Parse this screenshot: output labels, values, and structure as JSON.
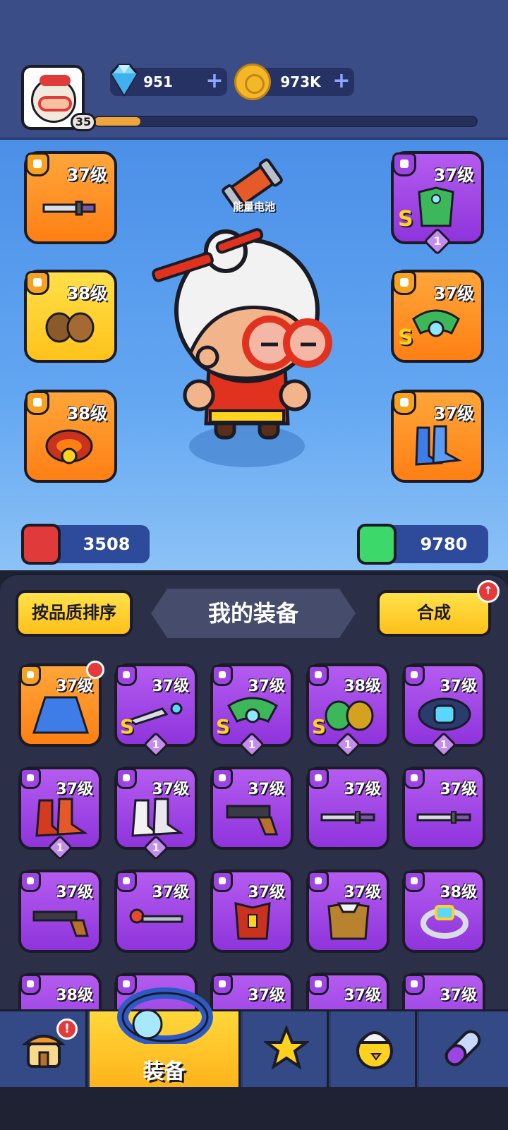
{
  "header": {
    "player_level": "35",
    "xp_fraction": 0.12,
    "gems": "951",
    "coins": "973K",
    "plus_symbol": "+"
  },
  "equipped": {
    "left": [
      {
        "level": "37级",
        "item": "knife-icon",
        "frame": "orange"
      },
      {
        "level": "38级",
        "item": "gloves-icon",
        "frame": "yellow"
      },
      {
        "level": "38级",
        "item": "belt-icon",
        "frame": "orange"
      }
    ],
    "right": [
      {
        "level": "37级",
        "item": "armor-icon",
        "frame": "purple",
        "rank": "S",
        "count": "1"
      },
      {
        "level": "37级",
        "item": "amulet-icon",
        "frame": "orange",
        "rank": "S"
      },
      {
        "level": "37级",
        "item": "boots-icon",
        "frame": "orange"
      }
    ]
  },
  "battery_label": "能量电池",
  "stats": {
    "attack": "3508",
    "health": "9780"
  },
  "inventory": {
    "sort_button": "按品质排序",
    "title": "我的装备",
    "merge_button": "合成",
    "rows": [
      [
        {
          "level": "37级",
          "item": "cape-icon",
          "frame": "orange",
          "new": true
        },
        {
          "level": "37级",
          "item": "dagger-icon",
          "rank": "S",
          "count": "1"
        },
        {
          "level": "37级",
          "item": "amulet-icon",
          "rank": "S",
          "count": "1"
        },
        {
          "level": "38级",
          "item": "gloves-icon",
          "rank": "S",
          "count": "1"
        },
        {
          "level": "37级",
          "item": "belt-icon",
          "count": "1"
        }
      ],
      [
        {
          "level": "37级",
          "item": "red-boots-icon",
          "count": "1"
        },
        {
          "level": "37级",
          "item": "white-boots-icon",
          "count": "1"
        },
        {
          "level": "37级",
          "item": "pistol-icon"
        },
        {
          "level": "37级",
          "item": "knife-icon"
        },
        {
          "level": "37级",
          "item": "knife-icon"
        }
      ],
      [
        {
          "level": "37级",
          "item": "shotgun-icon"
        },
        {
          "level": "37级",
          "item": "wand-icon"
        },
        {
          "level": "37级",
          "item": "vest-icon"
        },
        {
          "level": "37级",
          "item": "jacket-icon"
        },
        {
          "level": "38级",
          "item": "ring-icon"
        }
      ],
      [
        {
          "level": "38级",
          "item": "ring-icon"
        },
        {
          "level": "",
          "item": "ring-icon"
        },
        {
          "level": "37级",
          "item": "ring-icon"
        },
        {
          "level": "37级",
          "item": "ring-icon"
        },
        {
          "level": "37级",
          "item": "ring-icon"
        }
      ]
    ]
  },
  "nav": {
    "items": [
      {
        "name": "shop",
        "icon": "shop-icon",
        "badge": "!"
      },
      {
        "name": "equipment",
        "icon": "ring-icon",
        "label": "装备",
        "active": true
      },
      {
        "name": "arsenal",
        "icon": "star-guns-icon"
      },
      {
        "name": "pets",
        "icon": "chick-icon"
      },
      {
        "name": "skills",
        "icon": "pill-icon"
      }
    ]
  },
  "colors": {
    "accent_yellow": "#ffc21a",
    "rarity_purple": "#9c44e4",
    "rarity_orange": "#ff7f14",
    "badge_red": "#e43a3a"
  }
}
